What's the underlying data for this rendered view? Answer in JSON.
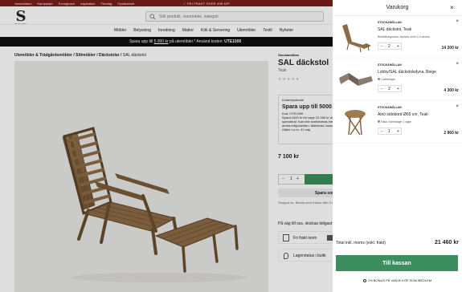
{
  "topbar": {
    "links": [
      "Varumärken",
      "Kampanjer",
      "Formgivare",
      "Inspiration",
      "Företag",
      "Fyndarkivet"
    ],
    "promo": "✓ FRI FRAKT ÖVER 495 KR*"
  },
  "header": {
    "logo_mark": "S",
    "logo_text": "Stockamöllan",
    "search_placeholder": "Sök produkt, varumärke, kategori"
  },
  "nav": {
    "items": [
      "Möbler",
      "Belysning",
      "Inredning",
      "Mattor",
      "Kök & Servering",
      "Utemöbler",
      "Textil",
      "Nyheter"
    ]
  },
  "campaign": {
    "text_before": "Spara upp till ",
    "amount": "5 000 kr",
    "text_mid": " på utemöbler.* Använd koden: ",
    "code": "UTE1000"
  },
  "breadcrumb": {
    "path": "Utemöbler & Trädgårdsmöbler / Sittmöbler / Däckstolar / ",
    "current": "SAL däckstol"
  },
  "product": {
    "brand": "Stockamöllan",
    "title": "SAL däckstol",
    "material": "Teak",
    "rating": "★★★★★",
    "campaign_badge": "Koderbjudande",
    "campaign_title": "Spara upp till 5000",
    "campaign_code": "Kod: UTE1000",
    "campaign_body": "Spara 1000 kr för varje 10 000 kr du spenderar. Kan inte kombineras med andra erbjudanden. Aktiveras i kassan.",
    "campaign_valid": "Gäller t.o.m. 31 maj",
    "price": "7 100 kr",
    "qty": "1",
    "shop_button": "Spara som",
    "klarna": "Shoppa nu. Betala med Klarna från 0 kr",
    "stock": "På väg till oss, skickas tidigast",
    "delivery_label": "Fri frakt inom",
    "store_label": "Lagerstatus i butik"
  },
  "cart": {
    "title": "Varukorg",
    "close": "×",
    "items": [
      {
        "brand": "STOCKAMÖLLAN",
        "name": "SAL däckstol, Teak",
        "status": "Beställningsvara, skickas inom 2-3 veckor",
        "qty": "2",
        "price": "14 200 kr"
      },
      {
        "brand": "STOCKAMÖLLAN",
        "name": "Lobby/SAL däckstolsdyna, Beige",
        "status": "I webblager",
        "qty": "2",
        "price": "4 300 kr"
      },
      {
        "brand": "STOCKAMÖLLAN",
        "name": "Alnö sidobord Ø65 cm, Teak",
        "status": "Fåtal i webblager 1 lager",
        "qty": "1",
        "price": "2 960 kr"
      }
    ],
    "total_label": "Total inkl. moms (exkl. frakt)",
    "total_value": "21 460 kr",
    "checkout": "Till kassan",
    "bonus": "2% BONUS PÅ VARJE KÖP SOM MEDLEM"
  },
  "colors": {
    "topbar": "#7a1f1a",
    "campaign": "#0e0e0e",
    "accent_green": "#3b8f5e",
    "teak": "#8b6b45"
  }
}
